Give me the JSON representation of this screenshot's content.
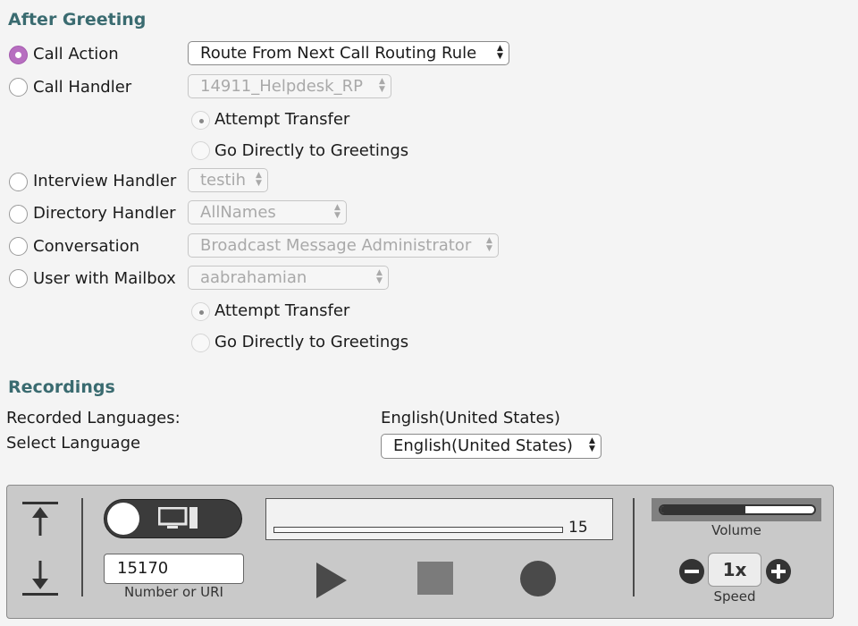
{
  "after_greeting": {
    "title": "After Greeting",
    "options": {
      "call_action": {
        "label": "Call Action",
        "value": "Route From Next Call Routing Rule",
        "selected": true
      },
      "call_handler": {
        "label": "Call Handler",
        "value": "14911_Helpdesk_RP"
      },
      "call_handler_sub": [
        "Attempt Transfer",
        "Go Directly to Greetings"
      ],
      "interview_handler": {
        "label": "Interview Handler",
        "value": "testih"
      },
      "directory_handler": {
        "label": "Directory Handler",
        "value": "AllNames"
      },
      "conversation": {
        "label": "Conversation",
        "value": "Broadcast Message Administrator"
      },
      "user_with_mailbox": {
        "label": "User with Mailbox",
        "value": "aabrahamian"
      },
      "user_sub": [
        "Attempt Transfer",
        "Go Directly to Greetings"
      ]
    }
  },
  "recordings": {
    "title": "Recordings",
    "recorded_languages_label": "Recorded Languages:",
    "recorded_languages_value": "English(United States)",
    "select_language_label": "Select Language",
    "select_language_value": "English(United States)"
  },
  "player": {
    "number_value": "15170",
    "number_caption": "Number or URI",
    "progress_seconds": "15",
    "volume_label": "Volume",
    "volume_level": 0.55,
    "speed_value": "1x",
    "speed_label": "Speed"
  },
  "colors": {
    "accent_purple": "#b76ec0",
    "section_title": "#3a6b70",
    "player_bg": "#c9c9c9"
  }
}
